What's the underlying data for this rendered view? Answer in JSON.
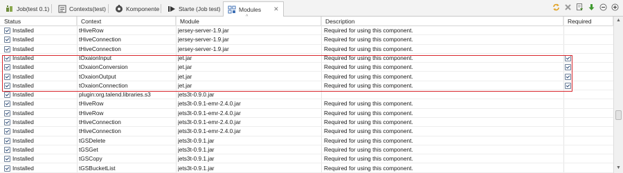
{
  "tabs": [
    {
      "label": "Job(test 0.1)",
      "icon": "job-icon"
    },
    {
      "label": "Contexts(test)",
      "icon": "contexts-icon"
    },
    {
      "label": "Komponente",
      "icon": "component-icon"
    },
    {
      "label": "Starte (Job test)",
      "icon": "run-icon"
    },
    {
      "label": "Modules",
      "icon": "modules-icon",
      "close": "✕"
    }
  ],
  "toolbar": {
    "icons": [
      "refresh-icon",
      "delete-icon",
      "import-icon",
      "download-icon",
      "collapse-icon",
      "add-icon"
    ]
  },
  "columns": {
    "status": "Status",
    "context": "Context",
    "module": "Module",
    "description": "Description",
    "required": "Required"
  },
  "rows": [
    {
      "status": "Installed",
      "context": "tHiveRow",
      "module": "jersey-server-1.9.jar",
      "description": "Required for using this component.",
      "required": false
    },
    {
      "status": "Installed",
      "context": "tHiveConnection",
      "module": "jersey-server-1.9.jar",
      "description": "Required for using this component.",
      "required": false
    },
    {
      "status": "Installed",
      "context": "tHiveConnection",
      "module": "jersey-server-1.9.jar",
      "description": "Required for using this component.",
      "required": false
    },
    {
      "status": "Installed",
      "context": "tOxaionInput",
      "module": "jet.jar",
      "description": "Required for using this component.",
      "required": true
    },
    {
      "status": "Installed",
      "context": "tOxaionConversion",
      "module": "jet.jar",
      "description": "Required for using this component.",
      "required": true
    },
    {
      "status": "Installed",
      "context": "tOxaionOutput",
      "module": "jet.jar",
      "description": "Required for using this component.",
      "required": true
    },
    {
      "status": "Installed",
      "context": "tOxaionConnection",
      "module": "jet.jar",
      "description": "Required for using this component.",
      "required": true
    },
    {
      "status": "Installed",
      "context": "plugin:org.talend.libraries.s3",
      "module": "jets3t-0.9.0.jar",
      "description": "",
      "required": false
    },
    {
      "status": "Installed",
      "context": "tHiveRow",
      "module": "jets3t-0.9.1-emr-2.4.0.jar",
      "description": "Required for using this component.",
      "required": false
    },
    {
      "status": "Installed",
      "context": "tHiveRow",
      "module": "jets3t-0.9.1-emr-2.4.0.jar",
      "description": "Required for using this component.",
      "required": false
    },
    {
      "status": "Installed",
      "context": "tHiveConnection",
      "module": "jets3t-0.9.1-emr-2.4.0.jar",
      "description": "Required for using this component.",
      "required": false
    },
    {
      "status": "Installed",
      "context": "tHiveConnection",
      "module": "jets3t-0.9.1-emr-2.4.0.jar",
      "description": "Required for using this component.",
      "required": false
    },
    {
      "status": "Installed",
      "context": "tGSDelete",
      "module": "jets3t-0.9.1.jar",
      "description": "Required for using this component.",
      "required": false
    },
    {
      "status": "Installed",
      "context": "tGSGet",
      "module": "jets3t-0.9.1.jar",
      "description": "Required for using this component.",
      "required": false
    },
    {
      "status": "Installed",
      "context": "tGSCopy",
      "module": "jets3t-0.9.1.jar",
      "description": "Required for using this component.",
      "required": false
    },
    {
      "status": "Installed",
      "context": "tGSBucketList",
      "module": "jets3t-0.9.1.jar",
      "description": "Required for using this component.",
      "required": false
    }
  ],
  "scrollbar": {
    "up": "▲",
    "down": "▼"
  },
  "sort_indicator": "^"
}
